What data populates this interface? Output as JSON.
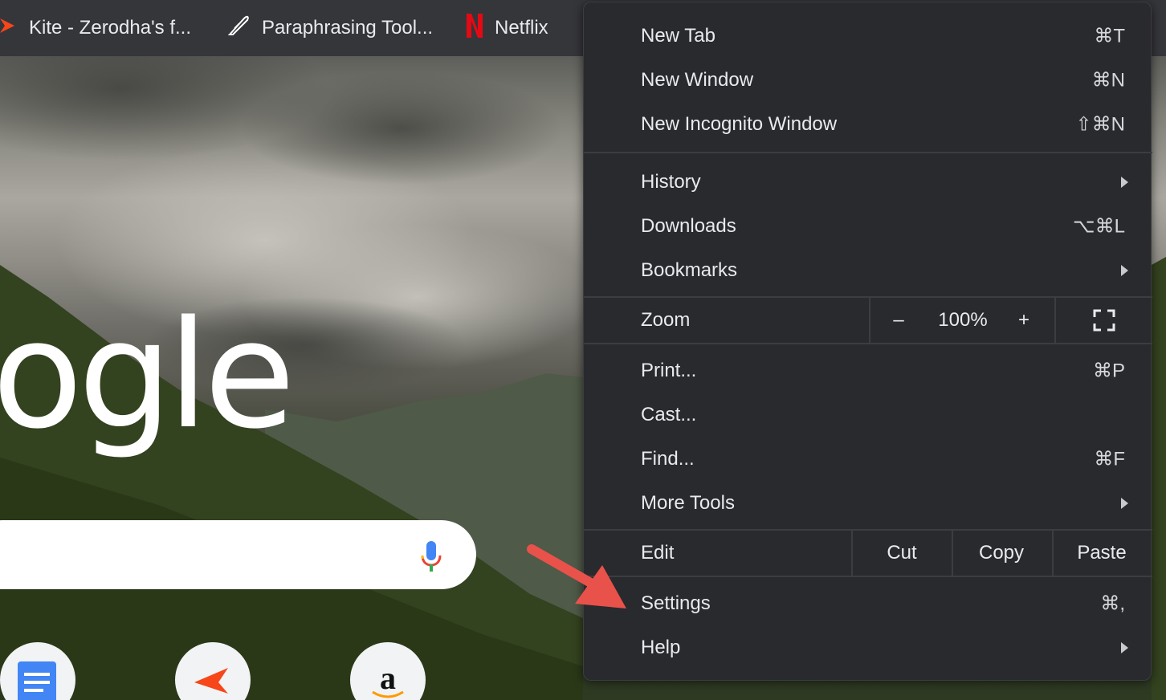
{
  "bookmarks": [
    {
      "label": "Kite - Zerodha's f...",
      "icon": "kite-icon"
    },
    {
      "label": "Paraphrasing Tool...",
      "icon": "quill-icon"
    },
    {
      "label": "Netflix",
      "icon": "netflix-icon"
    }
  ],
  "google_logo_text": "ogle",
  "menu": {
    "new_tab": {
      "label": "New Tab",
      "shortcut": "⌘T"
    },
    "new_window": {
      "label": "New Window",
      "shortcut": "⌘N"
    },
    "new_incognito": {
      "label": "New Incognito Window",
      "shortcut": "⇧⌘N"
    },
    "history": {
      "label": "History"
    },
    "downloads": {
      "label": "Downloads",
      "shortcut": "⌥⌘L"
    },
    "bookmarks": {
      "label": "Bookmarks"
    },
    "zoom": {
      "label": "Zoom",
      "minus": "–",
      "value": "100%",
      "plus": "+"
    },
    "print": {
      "label": "Print...",
      "shortcut": "⌘P"
    },
    "cast": {
      "label": "Cast..."
    },
    "find": {
      "label": "Find...",
      "shortcut": "⌘F"
    },
    "more_tools": {
      "label": "More Tools"
    },
    "edit": {
      "label": "Edit",
      "cut": "Cut",
      "copy": "Copy",
      "paste": "Paste"
    },
    "settings": {
      "label": "Settings",
      "shortcut": "⌘,"
    },
    "help": {
      "label": "Help"
    }
  },
  "colors": {
    "menu_bg": "#292a2d",
    "annotation_arrow": "#e8524a",
    "netflix_red": "#e50914",
    "kite_orange": "#f6461a"
  }
}
